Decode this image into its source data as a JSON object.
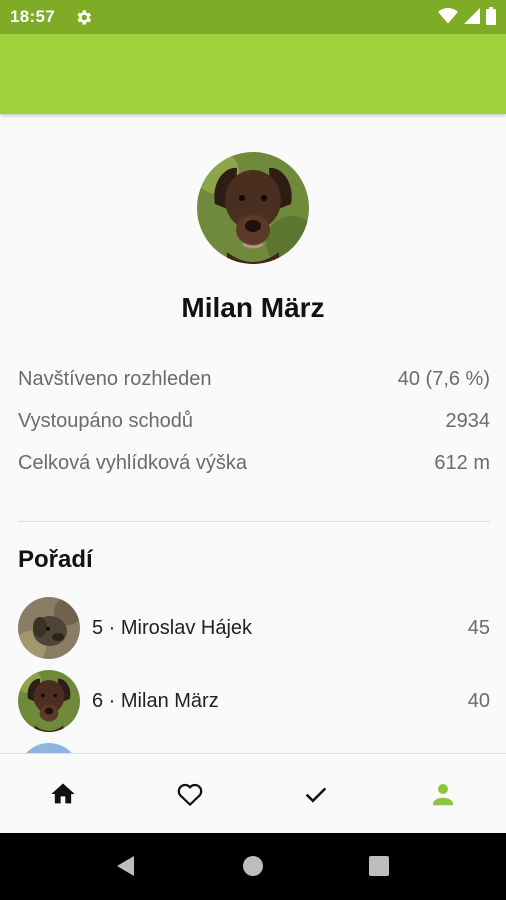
{
  "status_bar": {
    "time": "18:57",
    "background": "#7fac26",
    "icons": [
      "settings-icon",
      "wifi-icon",
      "signal-icon",
      "battery-icon"
    ]
  },
  "app_bar": {
    "background": "#9ed23d"
  },
  "profile": {
    "name": "Milan März",
    "avatar_icon": "dog-photo"
  },
  "stats": [
    {
      "label": "Navštíveno rozhleden",
      "value": "40 (7,6 %)"
    },
    {
      "label": "Vystoupáno schodů",
      "value": "2934"
    },
    {
      "label": "Celková vyhlídková výška",
      "value": "612 m"
    }
  ],
  "ranking": {
    "title": "Pořadí",
    "items": [
      {
        "text": "5 · Miroslav Hájek",
        "score": "45"
      },
      {
        "text": "6 · Milan März",
        "score": "40"
      }
    ]
  },
  "bottom_nav": {
    "items": [
      {
        "name": "home",
        "icon": "home-icon"
      },
      {
        "name": "favorites",
        "icon": "heart-icon"
      },
      {
        "name": "visited",
        "icon": "check-icon"
      },
      {
        "name": "profile",
        "icon": "person-icon",
        "active": true
      }
    ],
    "active_color": "#8cc63f",
    "inactive_color": "#111111"
  },
  "system_nav": {
    "icons": [
      "back-icon",
      "home-circle-icon",
      "recents-icon"
    ]
  }
}
